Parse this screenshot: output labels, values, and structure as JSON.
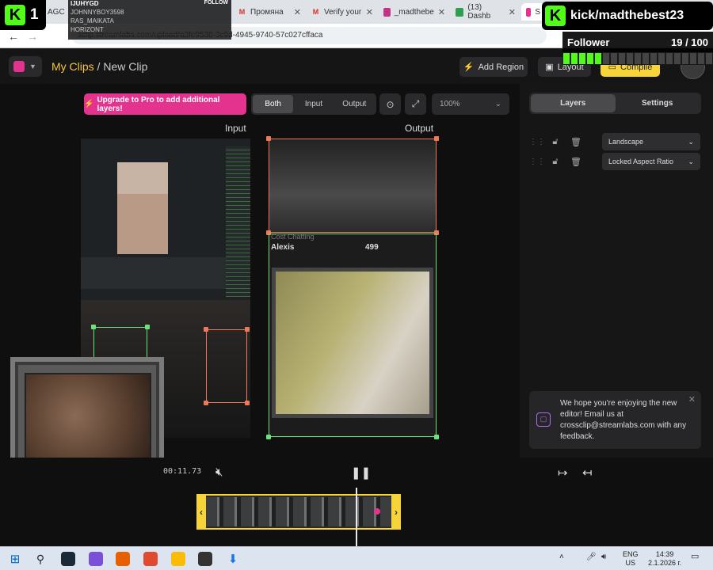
{
  "browser": {
    "tabs": [
      {
        "label": "AGC",
        "icon": "generic-tab-icon"
      },
      {
        "label": "Промяна",
        "icon": "gmail-icon"
      },
      {
        "label": "Verify your",
        "icon": "gmail-icon"
      },
      {
        "label": "_madthebe",
        "icon": "instagram-icon"
      },
      {
        "label": "(13) Dashb",
        "icon": "dashboard-icon"
      },
      {
        "label": "S",
        "icon": "streamlabs-icon"
      }
    ],
    "url": "sclip.streamlabs.com/upload/a3fe9538-3c9d-4945-9740-57c027cffaca"
  },
  "overlay": {
    "k1_count": "1",
    "mini_rows": [
      "IJUHYGD",
      "JOHNNYBOY3598",
      "RAS_MAIKATA",
      "HORIZONT"
    ],
    "mini_follow": "FOLLOW",
    "kick_name": "kick/madthebest23",
    "follower_label": "Follower",
    "follower_count": "19 / 100",
    "follower_progress": 0.19
  },
  "header": {
    "breadcrumb_link": "My Clips",
    "breadcrumb_sep": " / ",
    "breadcrumb_current": "New Clip",
    "add_region": "Add Region",
    "layout": "Layout",
    "compile": "Compile"
  },
  "toolbar": {
    "upgrade": "Upgrade to Pro to add additional layers!",
    "view_modes": [
      "Both",
      "Input",
      "Output"
    ],
    "active_view": "Both",
    "zoom": "100%"
  },
  "canvas": {
    "input_label": "Input",
    "output_label": "Output",
    "output_caption": "Cost Chatting",
    "output_name": "Alexis",
    "output_number": "499"
  },
  "panel": {
    "tabs": [
      "Layers",
      "Settings"
    ],
    "active_tab": "Layers",
    "layers": [
      {
        "value": "Landscape"
      },
      {
        "value": "Locked Aspect Ratio"
      }
    ],
    "toast_text": "We hope you're enjoying the new editor! Email us at crossclip@streamlabs.com with any feedback."
  },
  "player": {
    "time": "00:11.73"
  },
  "taskbar": {
    "lang_top": "ENG",
    "lang_bottom": "US",
    "clock": "14:39",
    "date": "2.1.2026 г."
  },
  "colors": {
    "accent_pink": "#e3338f",
    "accent_yellow": "#f7d43a",
    "kick_green": "#53fc18",
    "output_region": "#6ee07c",
    "input_region": "#ee7a5a"
  }
}
